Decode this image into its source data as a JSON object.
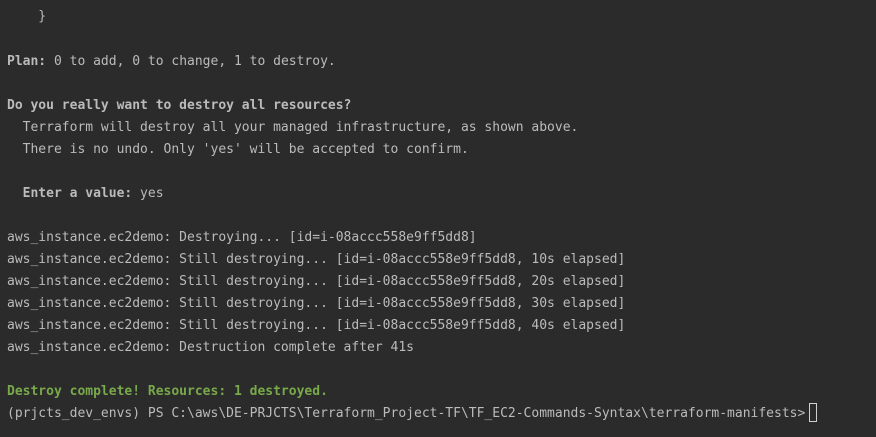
{
  "terminal": {
    "closing_brace": "    }",
    "plan": {
      "label": "Plan:",
      "text": " 0 to add, 0 to change, 1 to destroy."
    },
    "confirm": {
      "question": "Do you really want to destroy all resources?",
      "line1": "  Terraform will destroy all your managed infrastructure, as shown above.",
      "line2": "  There is no undo. Only 'yes' will be accepted to confirm.",
      "prompt_label": "  Enter a value:",
      "prompt_value": " yes"
    },
    "log": [
      "aws_instance.ec2demo: Destroying... [id=i-08accc558e9ff5dd8]",
      "aws_instance.ec2demo: Still destroying... [id=i-08accc558e9ff5dd8, 10s elapsed]",
      "aws_instance.ec2demo: Still destroying... [id=i-08accc558e9ff5dd8, 20s elapsed]",
      "aws_instance.ec2demo: Still destroying... [id=i-08accc558e9ff5dd8, 30s elapsed]",
      "aws_instance.ec2demo: Still destroying... [id=i-08accc558e9ff5dd8, 40s elapsed]",
      "aws_instance.ec2demo: Destruction complete after 41s"
    ],
    "summary": "Destroy complete! Resources: 1 destroyed.",
    "shell_prompt": "(prjcts_dev_envs) PS C:\\aws\\DE-PRJCTS\\Terraform_Project-TF\\TF_EC2-Commands-Syntax\\terraform-manifests>",
    "colors": {
      "background": "#2b2b2b",
      "text": "#bbbbbb",
      "success": "#78a94a"
    }
  }
}
